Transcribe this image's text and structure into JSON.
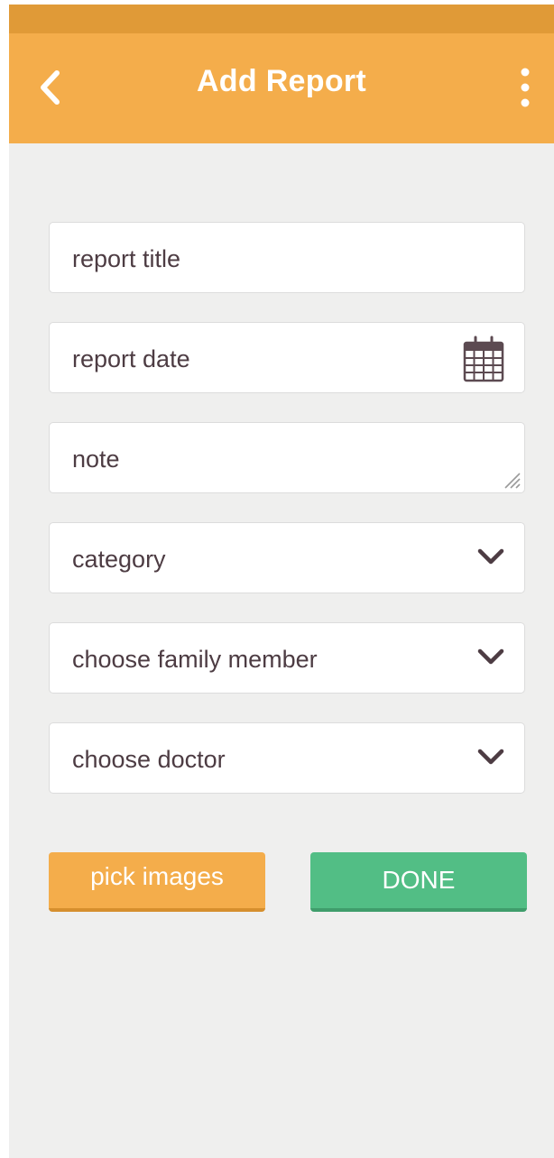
{
  "colors": {
    "status_bar": "#e09a37",
    "app_bar": "#f4ad4b",
    "background": "#efefee",
    "field_text": "#4d3c43",
    "accent_orange": "#f4ad4b",
    "accent_green": "#52be85"
  },
  "app_bar": {
    "title": "Add Report",
    "back_icon": "chevron-left-icon",
    "menu_icon": "more-vertical-icon"
  },
  "form": {
    "report_title": {
      "placeholder": "report title"
    },
    "report_date": {
      "placeholder": "report date",
      "icon": "calendar-icon"
    },
    "note": {
      "placeholder": "note"
    },
    "category": {
      "placeholder": "category",
      "icon": "chevron-down-icon"
    },
    "family_member": {
      "placeholder": "choose family member",
      "icon": "chevron-down-icon"
    },
    "doctor": {
      "placeholder": "choose doctor",
      "icon": "chevron-down-icon"
    }
  },
  "actions": {
    "pick_images_label": "pick images",
    "done_label": "DONE"
  }
}
